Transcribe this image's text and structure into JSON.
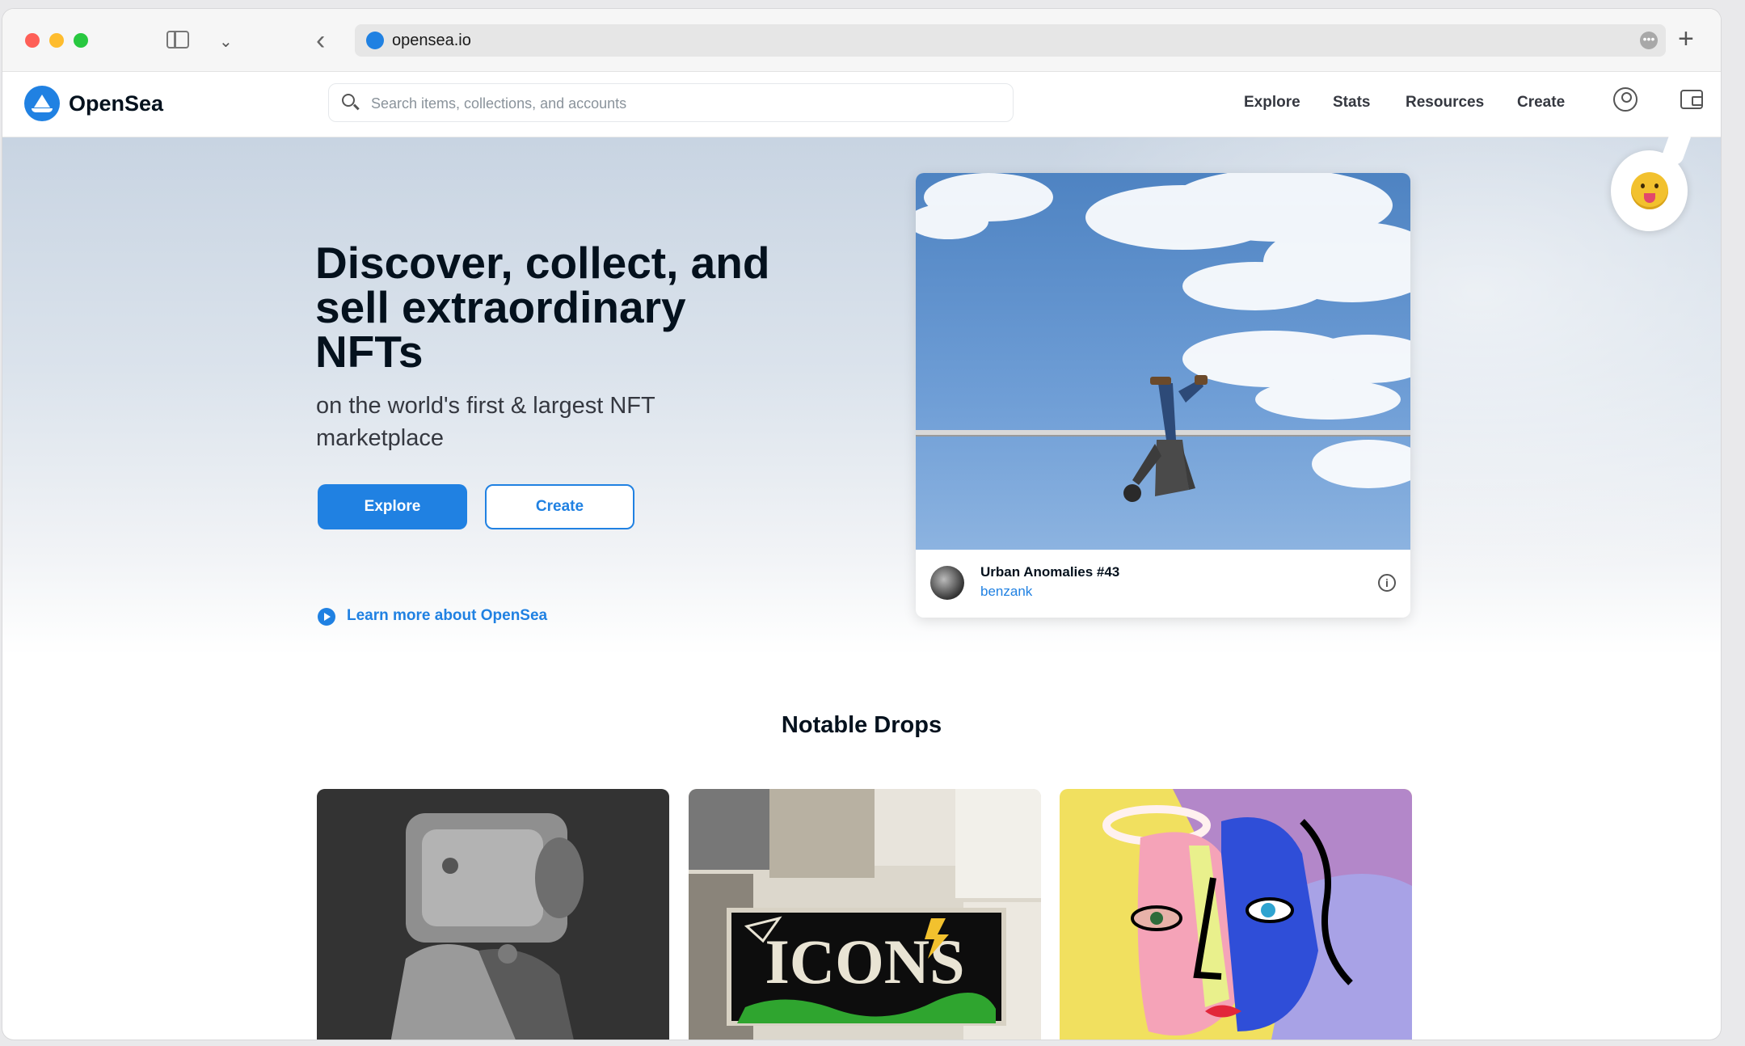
{
  "browser": {
    "url": "opensea.io"
  },
  "header": {
    "brand": "OpenSea",
    "search_placeholder": "Search items, collections, and accounts",
    "nav": [
      {
        "label": "Explore"
      },
      {
        "label": "Stats"
      },
      {
        "label": "Resources"
      },
      {
        "label": "Create"
      }
    ]
  },
  "hero": {
    "title": "Discover, collect, and sell extraordinary NFTs",
    "subtitle": "on the world's first & largest NFT marketplace",
    "primary_button": "Explore",
    "secondary_button": "Create",
    "learn_more": "Learn more about OpenSea",
    "featured": {
      "name": "Urban Anomalies #43",
      "creator": "benzank"
    }
  },
  "notable_drops": {
    "title": "Notable Drops",
    "cards": [
      {
        "image_label": ""
      },
      {
        "image_label": "ICONS"
      },
      {
        "image_label": ""
      }
    ]
  },
  "colors": {
    "accent": "#2081e2",
    "text_primary": "#04111d"
  }
}
